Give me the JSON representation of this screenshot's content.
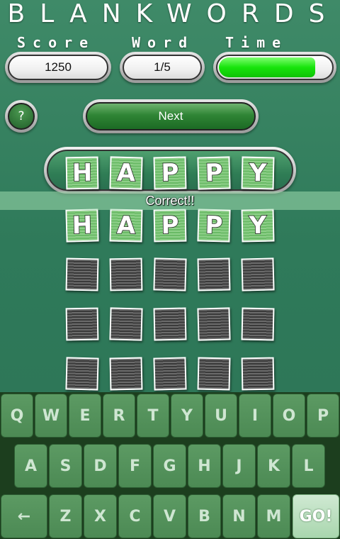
{
  "app": {
    "title": "BLANKWORDS"
  },
  "header": {
    "score_label": "Score",
    "word_label": "Word",
    "time_label": "Time",
    "score_value": "1250",
    "word_value": "1/5",
    "time_fraction": 0.84,
    "time_color": "#17e40c"
  },
  "controls": {
    "help_label": "?",
    "next_label": "Next"
  },
  "guess": {
    "letters": [
      "H",
      "A",
      "P",
      "P",
      "Y"
    ]
  },
  "status": {
    "message": "Correct!!"
  },
  "board": {
    "rows": [
      [
        "H",
        "A",
        "P",
        "P",
        "Y"
      ],
      [
        "",
        "",
        "",
        "",
        ""
      ],
      [
        "",
        "",
        "",
        "",
        ""
      ],
      [
        "",
        "",
        "",
        "",
        ""
      ]
    ]
  },
  "keyboard": {
    "row1": [
      "Q",
      "W",
      "E",
      "R",
      "T",
      "Y",
      "U",
      "I",
      "O",
      "P"
    ],
    "row2": [
      "A",
      "S",
      "D",
      "F",
      "G",
      "H",
      "J",
      "K",
      "L"
    ],
    "row3": [
      "←",
      "Z",
      "X",
      "C",
      "V",
      "B",
      "N",
      "M",
      "GO!"
    ]
  }
}
